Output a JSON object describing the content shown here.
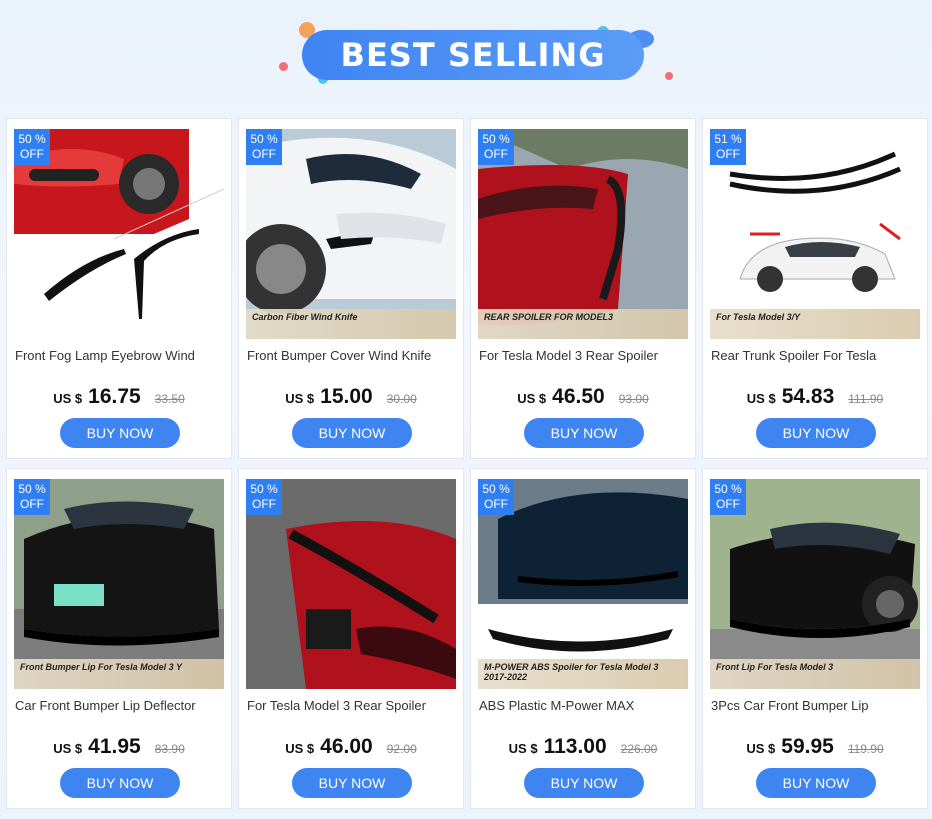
{
  "banner": {
    "title": "BEST SELLING"
  },
  "colors": {
    "accent": "#3e85f1",
    "badge": "#2f7ef2"
  },
  "products": [
    {
      "discount_pct": "50 %",
      "discount_off": "OFF",
      "title": "Front Fog Lamp Eyebrow Wind",
      "currency": "US $",
      "price": "16.75",
      "old_price": "33.50",
      "buy_label": "BUY NOW",
      "scene": "red-car-fog-lamp",
      "caption": ""
    },
    {
      "discount_pct": "50 %",
      "discount_off": "OFF",
      "title": "Front Bumper Cover Wind Knife",
      "currency": "US $",
      "price": "15.00",
      "old_price": "30.00",
      "buy_label": "BUY NOW",
      "scene": "white-car-bumper",
      "caption": "Carbon Fiber Wind Knife"
    },
    {
      "discount_pct": "50 %",
      "discount_off": "OFF",
      "title": "For Tesla Model 3 Rear Spoiler",
      "currency": "US $",
      "price": "46.50",
      "old_price": "93.00",
      "buy_label": "BUY NOW",
      "scene": "red-car-spoiler",
      "caption": "REAR SPOILER FOR MODEL3"
    },
    {
      "discount_pct": "51 %",
      "discount_off": "OFF",
      "title": "Rear Trunk Spoiler For Tesla",
      "currency": "US $",
      "price": "54.83",
      "old_price": "111.90",
      "buy_label": "BUY NOW",
      "scene": "white-car-spoiler",
      "caption": "For Tesla Model 3/Y"
    },
    {
      "discount_pct": "50 %",
      "discount_off": "OFF",
      "title": "Car Front Bumper Lip Deflector",
      "currency": "US $",
      "price": "41.95",
      "old_price": "83.90",
      "buy_label": "BUY NOW",
      "scene": "black-car-lip",
      "caption": "Front Bumper Lip For Tesla Model 3 Y"
    },
    {
      "discount_pct": "50 %",
      "discount_off": "OFF",
      "title": "For Tesla Model 3 Rear Spoiler",
      "currency": "US $",
      "price": "46.00",
      "old_price": "92.00",
      "buy_label": "BUY NOW",
      "scene": "red-car-trunk",
      "caption": ""
    },
    {
      "discount_pct": "50 %",
      "discount_off": "OFF",
      "title": "ABS Plastic M-Power MAX",
      "currency": "US $",
      "price": "113.00",
      "old_price": "226.00",
      "buy_label": "BUY NOW",
      "scene": "blue-car-mpower",
      "caption": "M-POWER ABS Spoiler for Tesla Model 3 2017-2022"
    },
    {
      "discount_pct": "50 %",
      "discount_off": "OFF",
      "title": "3Pcs Car Front Bumper Lip",
      "currency": "US $",
      "price": "59.95",
      "old_price": "119.90",
      "buy_label": "BUY NOW",
      "scene": "black-car-front-lip",
      "caption": "Front Lip For Tesla Model 3"
    }
  ]
}
